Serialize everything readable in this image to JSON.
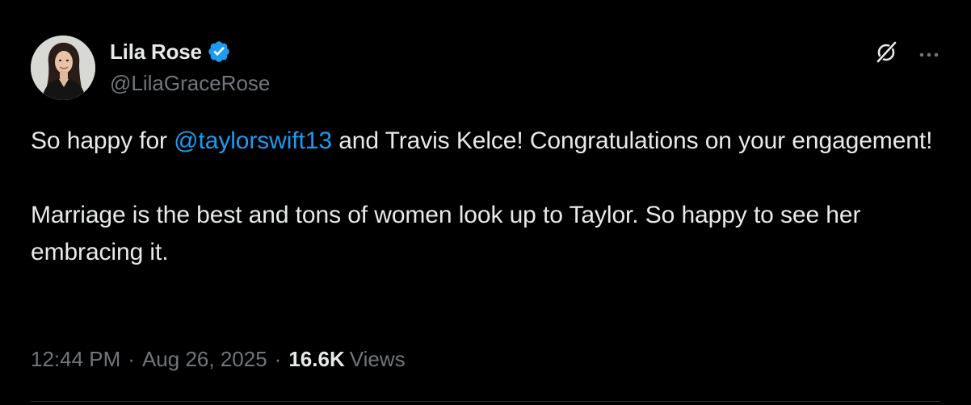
{
  "author": {
    "display_name": "Lila Rose",
    "handle": "@LilaGraceRose",
    "verified": true,
    "avatar_icon": "profile-photo"
  },
  "actions": {
    "grok_icon": "grok-icon",
    "more_icon": "more-options-icon"
  },
  "tweet": {
    "paragraph_1": {
      "before_mention": "So happy for ",
      "mention": "@taylorswift13",
      "after_mention": " and Travis Kelce! Congratulations on your engagement!"
    },
    "paragraph_2": "Marriage is the best and tons of women look up to Taylor. So happy to see her embracing it."
  },
  "meta": {
    "time": "12:44 PM",
    "separator": "·",
    "date": "Aug 26, 2025",
    "views_count": "16.6K",
    "views_label": "Views"
  },
  "colors": {
    "background": "#000000",
    "text_primary": "#e7e9ea",
    "text_secondary": "#71767b",
    "link": "#1d9bf0",
    "verified_badge": "#1d9bf0",
    "divider": "#2f3336"
  }
}
